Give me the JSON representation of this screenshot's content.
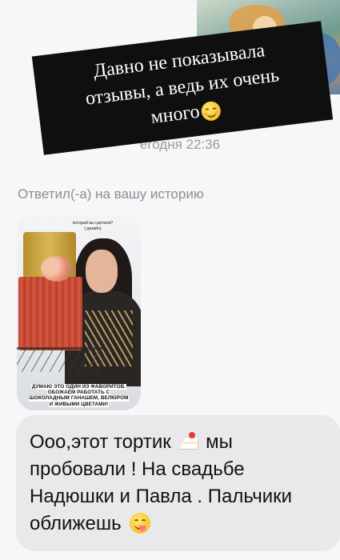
{
  "caption": {
    "line1": "Давно не показывала",
    "line2": "отзывы, а ведь их очень",
    "line3": "много",
    "emoji": "smiling-face-icon"
  },
  "thread": {
    "timestamp": "егодня 22:36",
    "reply_label": "Ответил(-а) на вашу историю"
  },
  "story": {
    "question_line1": "который вы сделали?",
    "question_line2": "( дизайн)",
    "overlay_line1": "ДУМАЮ ЭТО ОДИН ИЗ ФАВОРИТОВ.",
    "overlay_line2": "ОБОЖАЕМ РАБОТАТЬ С",
    "overlay_line3": "ШОКОЛАДНЫМ ГАНАШЕМ, ВЕЛЮРОМ",
    "overlay_line4": "И ЖИВЫМИ ЦВЕТАМИ!"
  },
  "message": {
    "part1": "Ооо,этот  тортик",
    "cake_emoji": "shortcake-icon",
    "part2": "мы пробовали ! На свадьбе Надюшки и Павла . Пальчики оближешь",
    "yum_emoji": "face-savoring-food-icon"
  }
}
